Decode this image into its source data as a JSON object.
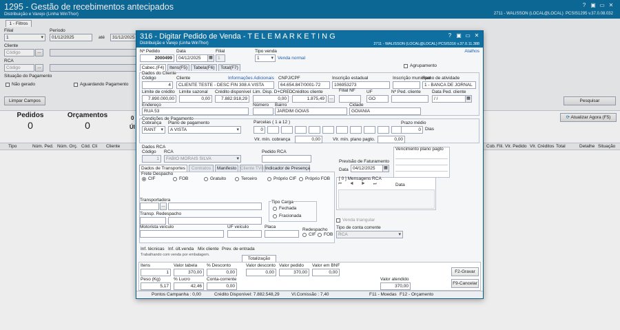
{
  "main": {
    "title": "1295 - Gestão de recebimentos antecipados",
    "subtitle": "Distribuição e Varejo (Linha WinThor)",
    "status": "2711 - WALISSON (LOCAL@LOCAL)",
    "version": "PCSIS1295  v.37.0.08.032",
    "ctl": [
      "?",
      "▣",
      "▭",
      "✕"
    ]
  },
  "filters": {
    "tab": "1 - Filtros",
    "filial_label": "Filial",
    "filial_value": "1",
    "periodo_label": "Período",
    "date_from": "01/12/2025",
    "ate": "até",
    "date_to": "31/12/2025",
    "cliente_label": "Cliente",
    "cliente_ph": "Código",
    "rca_label": "RCA",
    "rca_ph": "Código",
    "situacao_label": "Situação do Pagamento",
    "nao_gerado": "Não gerado",
    "aguardando": "Aguardando Pagamento",
    "limpar": "Limpar Campos",
    "pesquisar": "Pesquisar",
    "atualizar": "Atualizar Agora (F5)"
  },
  "counters": {
    "pedidos_label": "Pedidos",
    "pedidos_value": "0",
    "orcamentos_label": "Orçamentos",
    "orcamentos_value": "0",
    "third_label": "0",
    "third_value": "Úl"
  },
  "grid": {
    "cols_left": [
      "Tipo",
      "Núm. Ped.",
      "Núm. Orç.",
      "Cód. Cli",
      "Cliente"
    ],
    "cols_right": [
      "Cob.",
      "Fili.",
      "Vlr. Pedido",
      "Vlr. Créditos",
      "Total",
      "Detalhe",
      "Situação"
    ]
  },
  "dialog": {
    "title": "316 - Digitar Pedido de Venda - T E L E M A R K E T I N G",
    "subtitle": "Distribuição e Varejo (Linha WinThor)",
    "status": "2711 - WALISSON (LOCAL@LOCAL)   PCSIS316  v.37.0.11.388",
    "atalhos": "Atalhos",
    "ctl": [
      "?",
      "▣",
      "▭",
      "✕"
    ],
    "num_pedido_label": "Nº Pedido",
    "num_pedido": "2000499",
    "data_label": "Data",
    "data": "04/12/2025",
    "filial_label": "Filial",
    "filial": "1",
    "tipo_venda_label": "Tipo venda",
    "tipo_venda": "1",
    "venda_normal": "Venda normal",
    "agrupamento": "Agrupamento",
    "tabs": [
      "Cabec.(F4)",
      "Itens(F5)",
      "Tabela(F6)",
      "Total(F7)"
    ],
    "dados_cliente": "Dados do Cliente",
    "codigo_label": "Código",
    "codigo": "4",
    "cliente_label": "Cliente",
    "cliente": "CLIENTE TESTE - DESC FIN 308 A VISTA",
    "info_adicionais": "Informações Adicionais",
    "cnpj_label": "CNPJ/CPF",
    "cnpj": "64.654.847/0001-72",
    "ie_label": "Inscrição estadual",
    "ie": "106953273",
    "im_label": "Inscrição municipal",
    "im": "",
    "ramo_label": "Ramo de atividade",
    "ramo": "1 - BANCA DE JORNAL",
    "limite_label": "Limite de crédito",
    "limite": "7.890.000,00",
    "sazonal_label": "Limite sazonal",
    "sazonal": "0,00",
    "credito_label": "Crédito disponível",
    "credito": "7.882.918,29",
    "limdisp_label": "Lim. Disp. D+CRED",
    "limdisp": "0,00",
    "creditos_cli_label": "Créditos cliente",
    "creditos_cli": "1.875,49",
    "filialnf_label": "Filial NF",
    "filialnf": "",
    "uf_label": "UF",
    "uf": "GO",
    "nped_label": "Nº Ped. cliente",
    "nped": "",
    "dataped_label": "Data Ped. cliente",
    "dataped": "/ /",
    "endereco_label": "Endereço",
    "endereco": "RUA 53",
    "numero_label": "Número",
    "numero": "",
    "bairro_label": "Bairro",
    "bairro": "JARDIM GOIAS",
    "cidade_label": "Cidade",
    "cidade": "GOIANIA",
    "condicoes": "Condições de Pagamento",
    "cobranca_label": "Cobrança",
    "cobranca": "RANT",
    "plano_label": "Plano de pagamento",
    "plano": "A VISTA",
    "parcelas_label": "Parcelas ( 1 a 12 )",
    "parcela1": "0",
    "prazo_label": "Prazo médio",
    "prazo": "0",
    "dias": "Dias",
    "vlr_min_cob_label": "Vlr. mín. cobrança",
    "vlr_min_cob": "0,00",
    "vlr_min_plano_label": "Vlr. mín. plano pagto.",
    "vlr_min_plano": "0,00",
    "dados_rca": "Dados RCA",
    "rca_codigo_label": "Código",
    "rca_codigo": "1",
    "rca_label": "RCA",
    "rca": "FABIO MORAIS SILVA",
    "pedido_rca_label": "Pedido RCA",
    "pedido_rca": "",
    "venc_plano": "Vencimento plano pagto",
    "subtabs": [
      "Dados de Transportes",
      "Contratos",
      "Manifesto",
      "Cliente TV8",
      "Indicador de Presença"
    ],
    "previsao_label": "Previsão de Faturamento",
    "previsao_data_label": "Data",
    "previsao_data": "04/12/2025",
    "frete_label": "Frete Despacho",
    "frete_opts": [
      "CIF",
      "FOB",
      "Gratuito",
      "Terceiro",
      "Próprio CIF",
      "Próprio FOB"
    ],
    "mensagens": "[ 0 ] Mensagens RCA",
    "msg_data": "Data",
    "transportadora_label": "Transportadora",
    "redespacho_label": "Transp. Redespacho",
    "tipo_carga_label": "Tipo Carga",
    "fechada": "Fechada",
    "fracionada": "Fracionada",
    "venda_triangular": "Venda triangular",
    "motorista_label": "Motorista veículo",
    "uf_veiculo_label": "UF veículo",
    "placa_label": "Placa",
    "redespacho2_label": "Redespacho",
    "cif": "CIF",
    "fob": "FOB",
    "tipo_cc_label": "Tipo de conta corrente",
    "tipo_cc": "RCA",
    "bottom_tabs": [
      "Inf. técnicas",
      "Inf. últ.venda",
      "Mix cliente",
      "Prev. de entrada"
    ],
    "trabalhando": "Trabalhando com venda por embalagem.",
    "totalizacao": "Totalização",
    "itens_label": "Itens",
    "itens": "1",
    "vlr_tabela_label": "Valor tabela",
    "vlr_tabela": "370,00",
    "pct_desc_label": "% Desconto",
    "pct_desc": "0,00",
    "vlr_desc_label": "Valor desconto",
    "vlr_desc": "0,00",
    "vlr_pedido_label": "Valor pedido",
    "vlr_pedido": "370,00",
    "vlr_bnf_label": "Valor em BNF",
    "vlr_bnf": "0,00",
    "peso_label": "Peso (Kg)",
    "peso": "5,17",
    "lucro_label": "% Lucro",
    "lucro": "42,46",
    "cc_label": "Conta-corrente",
    "cc": "0,00",
    "vlr_atendido_label": "Valor atendido",
    "vlr_atendido": "370,00",
    "f2": "F2-Gravar",
    "f9": "F9-Cancelar",
    "status_pontos": "Pontos Campanha : 0,00",
    "status_credito": "Crédito Disponível: 7.882.548,29",
    "status_comissao": "Vl.Comissão : 7,40",
    "status_f11": "F11 - Moedas",
    "status_f12": "F12 - Orçamento"
  }
}
